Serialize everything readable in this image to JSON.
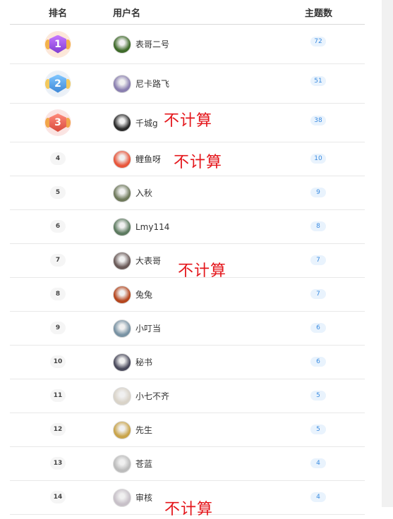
{
  "header": {
    "rank": "排名",
    "username": "用户名",
    "topics": "主题数"
  },
  "rows": [
    {
      "rank": "1",
      "user": "表哥二号",
      "topics": "72",
      "avatar_color": "#3f6b2a"
    },
    {
      "rank": "2",
      "user": "尼卡路飞",
      "topics": "51",
      "avatar_color": "#8a7fb0"
    },
    {
      "rank": "3",
      "user": "千城g",
      "topics": "38",
      "avatar_color": "#2b2b2b",
      "note": "不计算"
    },
    {
      "rank": "4",
      "user": "鲤鱼呀",
      "topics": "10",
      "avatar_color": "#e8563b",
      "note": "不计算"
    },
    {
      "rank": "5",
      "user": "入秋",
      "topics": "9",
      "avatar_color": "#6f7a5c"
    },
    {
      "rank": "6",
      "user": "Lmy114",
      "topics": "8",
      "avatar_color": "#5c7a5f"
    },
    {
      "rank": "7",
      "user": "大表哥",
      "topics": "7",
      "avatar_color": "#6a5a58",
      "note": "不计算"
    },
    {
      "rank": "8",
      "user": "兔兔",
      "topics": "7",
      "avatar_color": "#b5461e"
    },
    {
      "rank": "9",
      "user": "小叮当",
      "topics": "6",
      "avatar_color": "#7892a3"
    },
    {
      "rank": "10",
      "user": "秘书",
      "topics": "6",
      "avatar_color": "#4a4a5c"
    },
    {
      "rank": "11",
      "user": "小七不齐",
      "topics": "5",
      "avatar_color": "#d9d3c8"
    },
    {
      "rank": "12",
      "user": "先生",
      "topics": "5",
      "avatar_color": "#c9a44a"
    },
    {
      "rank": "13",
      "user": "苍蓝",
      "topics": "4",
      "avatar_color": "#bcbcbc"
    },
    {
      "rank": "14",
      "user": "审核",
      "topics": "4",
      "avatar_color": "#c7c0c8",
      "note": "不计算"
    }
  ]
}
